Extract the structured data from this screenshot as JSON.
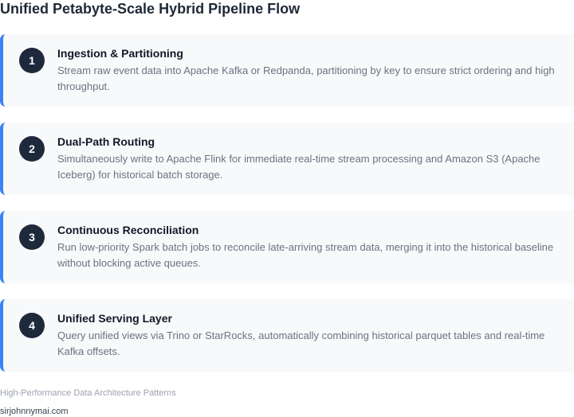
{
  "title": "Unified Petabyte-Scale Hybrid Pipeline Flow",
  "steps": [
    {
      "number": "1",
      "title": "Ingestion & Partitioning",
      "description": "Stream raw event data into Apache Kafka or Redpanda, partitioning by key to ensure strict ordering and high throughput."
    },
    {
      "number": "2",
      "title": "Dual-Path Routing",
      "description": "Simultaneously write to Apache Flink for immediate real-time stream processing and Amazon S3 (Apache Iceberg) for historical batch storage."
    },
    {
      "number": "3",
      "title": "Continuous Reconciliation",
      "description": "Run low-priority Spark batch jobs to reconcile late-arriving stream data, merging it into the historical baseline without blocking active queues."
    },
    {
      "number": "4",
      "title": "Unified Serving Layer",
      "description": "Query unified views via Trino or StarRocks, automatically combining historical parquet tables and real-time Kafka offsets."
    }
  ],
  "footer": {
    "caption": "High-Performance Data Architecture Patterns",
    "site": "sirjohnnymai.com"
  },
  "colors": {
    "accent": "#3b82f6",
    "badge": "#1e293b",
    "card_background": "#f8f9fb"
  }
}
